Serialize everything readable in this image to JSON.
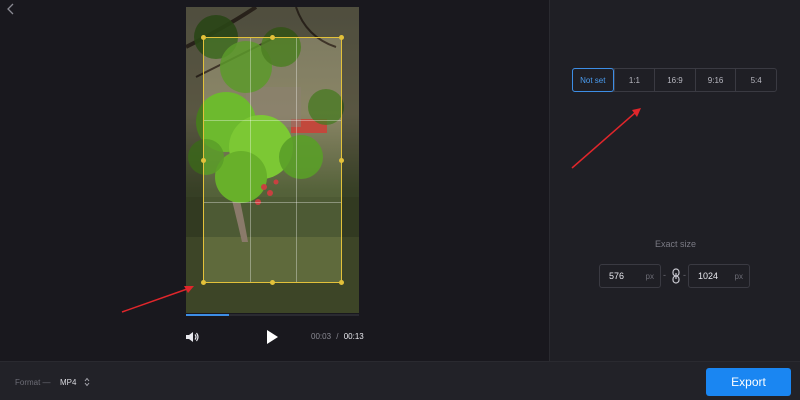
{
  "editor": {
    "back_icon": "chevron-left-icon",
    "player": {
      "current_time": "00:03",
      "separator": "/",
      "total_time": "00:13",
      "progress": 0.25,
      "volume_icon": "speaker-icon",
      "play_icon": "play-icon"
    }
  },
  "side_panel": {
    "aspect_ratios": [
      {
        "label": "Not set",
        "active": true
      },
      {
        "label": "1:1",
        "active": false
      },
      {
        "label": "16:9",
        "active": false
      },
      {
        "label": "9:16",
        "active": false
      },
      {
        "label": "5:4",
        "active": false
      }
    ],
    "exact_size_label": "Exact size",
    "width": {
      "value": "576",
      "unit": "px"
    },
    "height": {
      "value": "1024",
      "unit": "px"
    },
    "link_icon": "link-icon"
  },
  "bottom_bar": {
    "format_label": "Format —",
    "format_value": "MP4",
    "export_label": "Export"
  },
  "colors": {
    "accent": "#1a86f2",
    "crop_frame": "#e3c13a",
    "annotation_arrow": "#e0262b"
  }
}
